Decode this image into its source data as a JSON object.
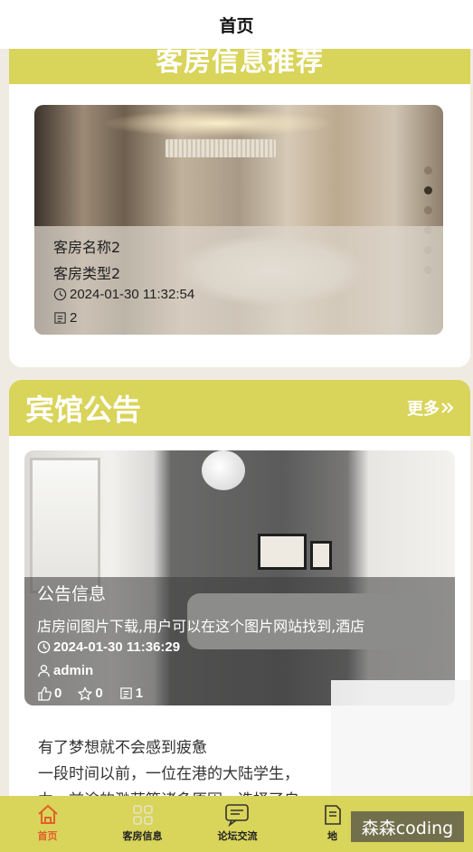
{
  "page": {
    "title": "首页"
  },
  "rooms": {
    "heading": "客房信息推荐",
    "card": {
      "name": "客房名称2",
      "type": "客房类型2",
      "time": "2024-01-30 11:32:54",
      "count": "2"
    }
  },
  "notice": {
    "heading": "宾馆公告",
    "more": "更多",
    "card": {
      "title": "公告信息",
      "summary": "店房间图片下载,用户可以在这个图片网站找到,酒店",
      "time": "2024-01-30 11:36:29",
      "author": "admin",
      "likes": "0",
      "stars": "0",
      "views": "1"
    },
    "article": [
      "有了梦想就不会感到疲惫",
      "一段时间以前，一位在港的大陆学生，",
      "力，前途的渺茫等诸多原因，选择了自"
    ]
  },
  "tabs": [
    {
      "label": "首页",
      "icon": "home-icon",
      "active": true
    },
    {
      "label": "客房信息",
      "icon": "grid-icon",
      "active": false
    },
    {
      "label": "论坛交流",
      "icon": "chat-icon",
      "active": false
    },
    {
      "label": "地",
      "icon": "note-icon",
      "active": false
    }
  ],
  "watermark": "森森coding",
  "colors": {
    "accent": "#d9d45a",
    "active_tab": "#e2612a",
    "background": "#f0ebe2"
  }
}
